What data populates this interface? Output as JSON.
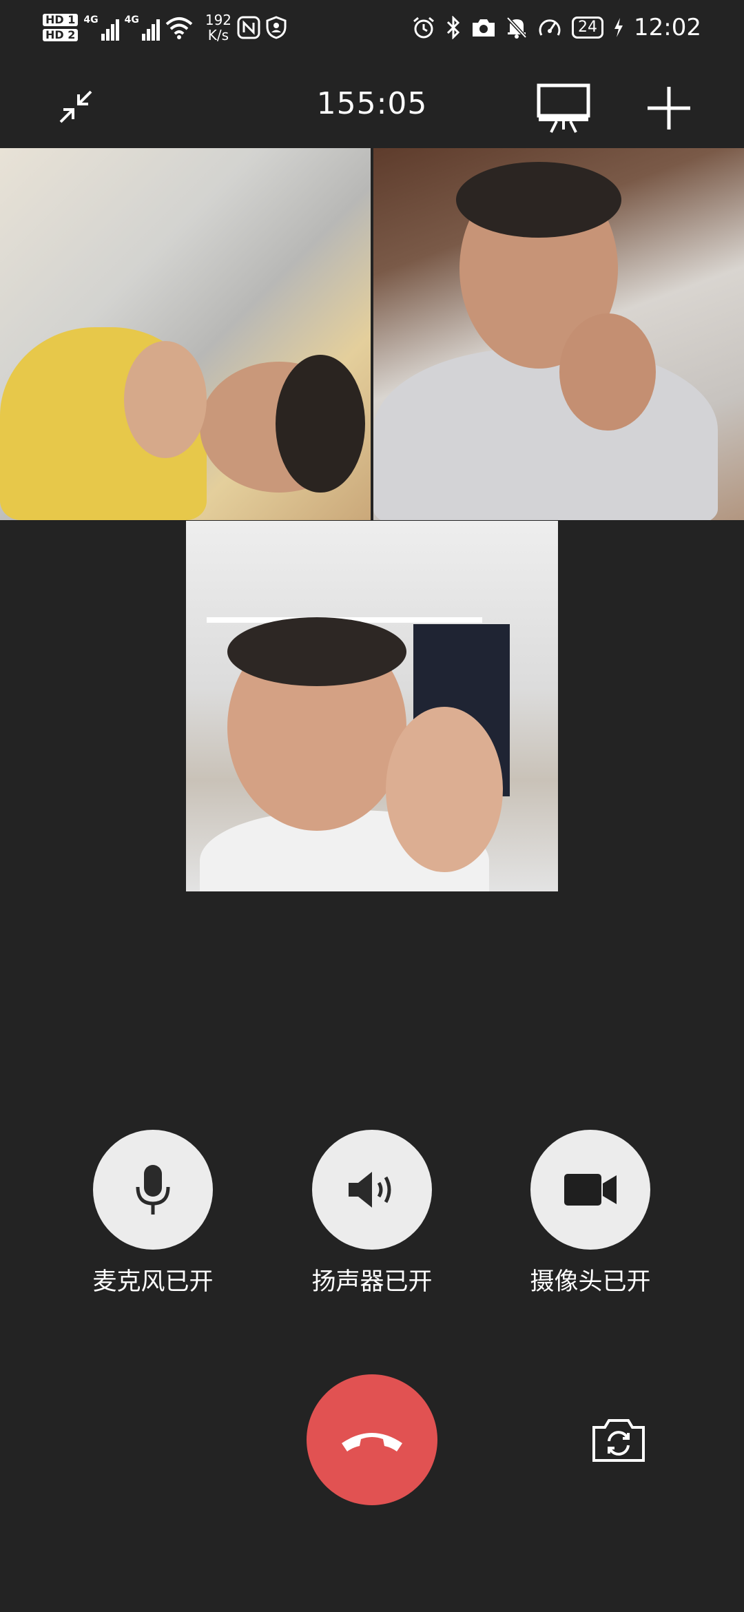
{
  "status_bar": {
    "sim1": "HD 1",
    "sim2": "HD 2",
    "network1": "4G",
    "network2": "4G",
    "speed_value": "192",
    "speed_unit": "K/s",
    "battery": "24",
    "time": "12:02"
  },
  "call": {
    "duration": "155:05"
  },
  "participants": [
    {
      "tile": "video-tile-1"
    },
    {
      "tile": "video-tile-2"
    },
    {
      "tile": "video-tile-3"
    }
  ],
  "controls": {
    "mic_label": "麦克风已开",
    "speaker_label": "扬声器已开",
    "camera_label": "摄像头已开"
  },
  "colors": {
    "background": "#232323",
    "control_circle": "#ececec",
    "hangup": "#e15252"
  },
  "icons": [
    "minimize-icon",
    "screen-share-icon",
    "add-icon",
    "microphone-icon",
    "speaker-icon",
    "camera-icon",
    "hangup-icon",
    "switch-camera-icon"
  ]
}
